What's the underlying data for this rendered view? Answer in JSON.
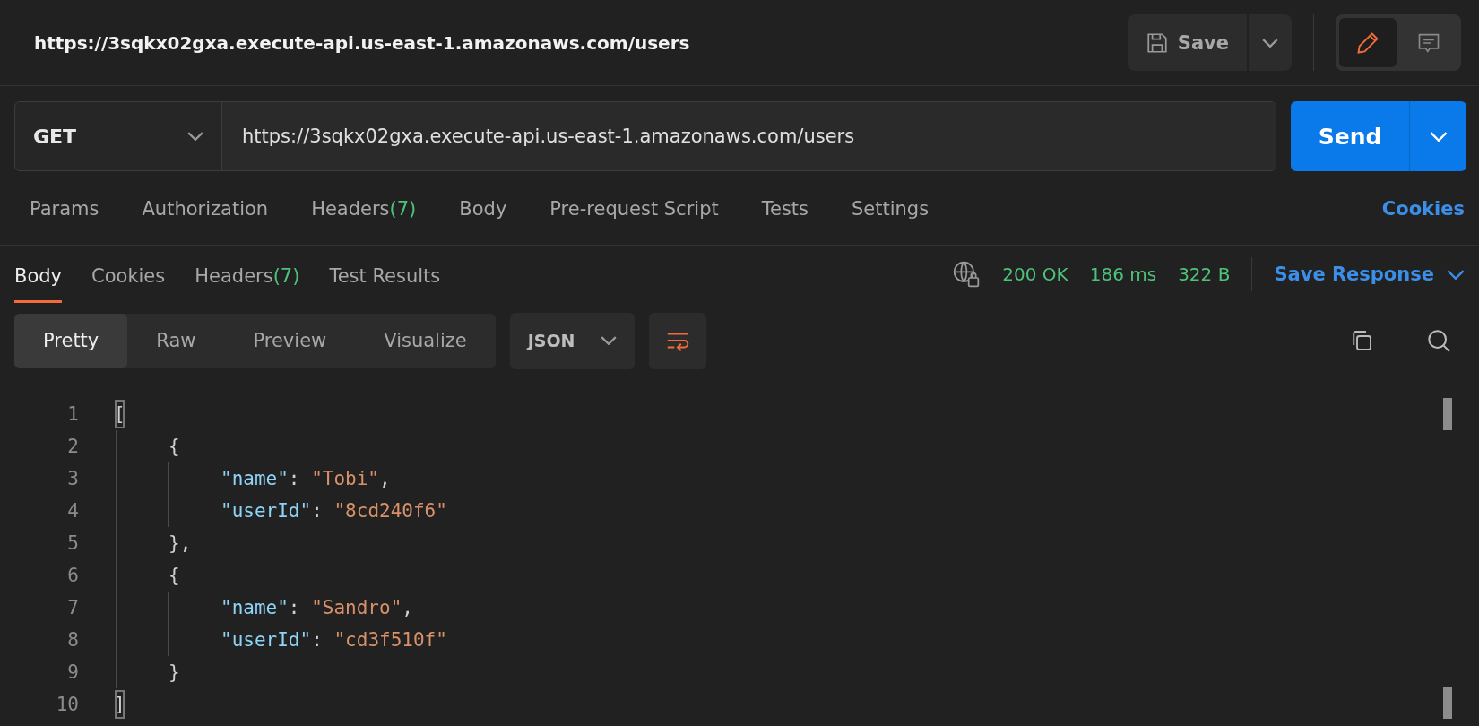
{
  "header": {
    "title": "https://3sqkx02gxa.execute-api.us-east-1.amazonaws.com/users",
    "save_label": "Save",
    "modes": [
      {
        "kind": "edit",
        "selected": true
      },
      {
        "kind": "comments",
        "selected": false
      }
    ]
  },
  "request": {
    "method": "GET",
    "url": "https://3sqkx02gxa.execute-api.us-east-1.amazonaws.com/users",
    "send_label": "Send"
  },
  "request_tabs": [
    {
      "label": "Params"
    },
    {
      "label": "Authorization"
    },
    {
      "label": "Headers",
      "count": "(7)"
    },
    {
      "label": "Body"
    },
    {
      "label": "Pre-request Script"
    },
    {
      "label": "Tests"
    },
    {
      "label": "Settings"
    }
  ],
  "cookies_link": "Cookies",
  "response_tabs": [
    {
      "label": "Body",
      "selected": true
    },
    {
      "label": "Cookies",
      "selected": false
    },
    {
      "label": "Headers",
      "count": "(7)",
      "selected": false
    },
    {
      "label": "Test Results",
      "selected": false
    }
  ],
  "status": {
    "code": "200 OK",
    "time": "186 ms",
    "size": "322 B",
    "save_response": "Save Response"
  },
  "view_modes": [
    {
      "label": "Pretty",
      "selected": true
    },
    {
      "label": "Raw",
      "selected": false
    },
    {
      "label": "Preview",
      "selected": false
    },
    {
      "label": "Visualize",
      "selected": false
    }
  ],
  "format": "JSON",
  "line_numbers": [
    "1",
    "2",
    "3",
    "4",
    "5",
    "6",
    "7",
    "8",
    "9",
    "10"
  ],
  "code": [
    {
      "matched": true,
      "tokens": [
        {
          "kind": "punct",
          "text": "["
        }
      ],
      "children": [
        {
          "matched": false,
          "tokens": [
            {
              "kind": "punct",
              "text": "{"
            }
          ],
          "children": [
            {
              "matched": false,
              "tokens": [
                {
                  "kind": "key",
                  "text": "\"name\""
                },
                {
                  "kind": "punct",
                  "text": ": "
                },
                {
                  "kind": "string",
                  "text": "\"Tobi\""
                },
                {
                  "kind": "punct",
                  "text": ","
                }
              ]
            },
            {
              "matched": false,
              "tokens": [
                {
                  "kind": "key",
                  "text": "\"userId\""
                },
                {
                  "kind": "punct",
                  "text": ": "
                },
                {
                  "kind": "string",
                  "text": "\"8cd240f6\""
                }
              ]
            }
          ]
        },
        {
          "matched": false,
          "tokens": [
            {
              "kind": "punct",
              "text": "},"
            }
          ]
        },
        {
          "matched": false,
          "tokens": [
            {
              "kind": "punct",
              "text": "{"
            }
          ],
          "children": [
            {
              "matched": false,
              "tokens": [
                {
                  "kind": "key",
                  "text": "\"name\""
                },
                {
                  "kind": "punct",
                  "text": ": "
                },
                {
                  "kind": "string",
                  "text": "\"Sandro\""
                },
                {
                  "kind": "punct",
                  "text": ","
                }
              ]
            },
            {
              "matched": false,
              "tokens": [
                {
                  "kind": "key",
                  "text": "\"userId\""
                },
                {
                  "kind": "punct",
                  "text": ": "
                },
                {
                  "kind": "string",
                  "text": "\"cd3f510f\""
                }
              ]
            }
          ]
        },
        {
          "matched": false,
          "tokens": [
            {
              "kind": "punct",
              "text": "}"
            }
          ]
        }
      ]
    },
    {
      "matched": true,
      "tokens": [
        {
          "kind": "punct",
          "text": "]"
        }
      ]
    }
  ]
}
